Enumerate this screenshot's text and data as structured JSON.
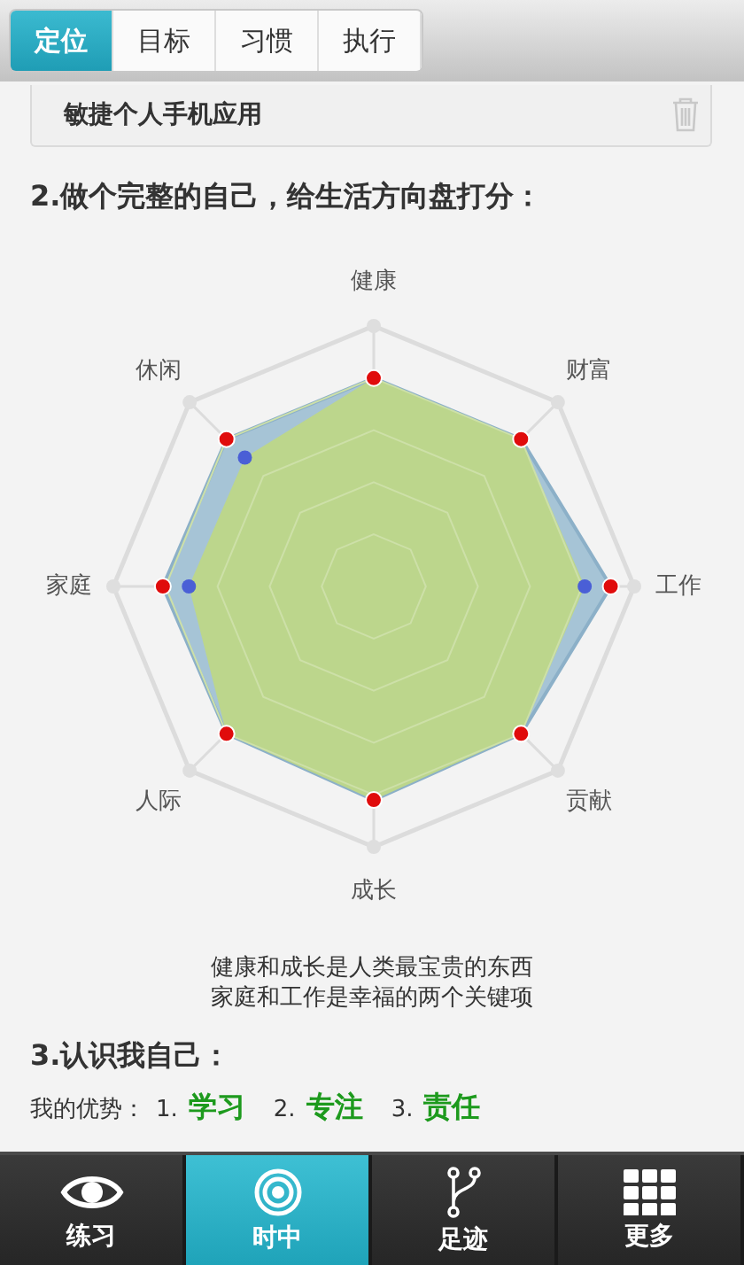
{
  "tabs": [
    {
      "label": "定位",
      "selected": true
    },
    {
      "label": "目标",
      "selected": false
    },
    {
      "label": "习惯",
      "selected": false
    },
    {
      "label": "执行",
      "selected": false
    }
  ],
  "entry": {
    "text": "敏捷个人手机应用"
  },
  "section_2": {
    "heading": "2.做个完整的自己，给生活方向盘打分：",
    "radar": {
      "axes": [
        "健康",
        "财富",
        "工作",
        "贡献",
        "成长",
        "人际",
        "家庭",
        "休闲"
      ]
    },
    "caption": [
      "健康和成长是人类最宝贵的东西",
      "家庭和工作是幸福的两个关键项"
    ]
  },
  "section_3": {
    "heading": "3.认识我自己：",
    "strengths": {
      "label": "我的优势：",
      "items": [
        {
          "number": "1.",
          "text": "学习"
        },
        {
          "number": "2.",
          "text": "专注"
        },
        {
          "number": "3.",
          "text": "责任"
        }
      ]
    }
  },
  "nav": [
    {
      "label": "练习",
      "selected": false
    },
    {
      "label": "时中",
      "selected": true
    },
    {
      "label": "足迹",
      "selected": false
    },
    {
      "label": "更多",
      "selected": false
    }
  ]
}
